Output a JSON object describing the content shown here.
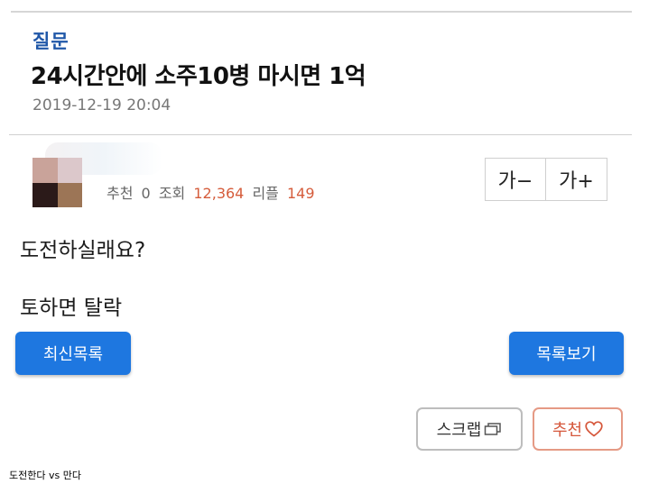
{
  "post": {
    "category": "질문",
    "title": "24시간안에 소주10병 마시면 1억",
    "date": "2019-12-19 20:04",
    "stats": {
      "recommend_label": "추천",
      "recommend_value": "0",
      "views_label": "조회",
      "views_value": "12,364",
      "replies_label": "리플",
      "replies_value": "149"
    },
    "body_lines": [
      "도전하실래요?",
      "토하면 탈락"
    ]
  },
  "font_controls": {
    "decrease_label": "가−",
    "increase_label": "가+"
  },
  "buttons": {
    "latest_label": "최신목록",
    "list_label": "목록보기",
    "scrap_label": "스크랩",
    "recommend_label": "추천"
  },
  "caption": "도전한다 vs 만다",
  "colors": {
    "category": "#1f57a8",
    "accent_number": "#d55c3b",
    "primary_button": "#1e77e0",
    "recommend_border": "#e59a85"
  },
  "icons": {
    "scrap": "copy-icon",
    "recommend": "heart-outline-icon"
  }
}
